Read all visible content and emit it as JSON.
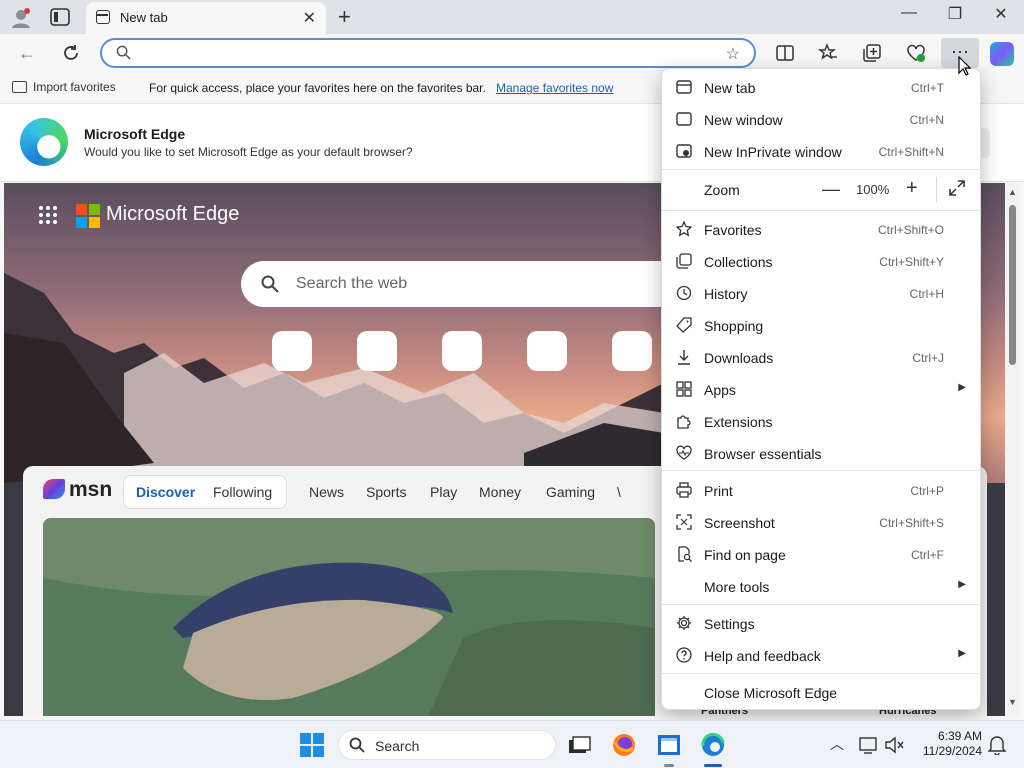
{
  "tab": {
    "title": "New tab"
  },
  "window": {
    "minimize": "—",
    "restore": "❐",
    "close": "✕"
  },
  "address": {
    "value": "",
    "placeholder": ""
  },
  "favorites_bar": {
    "import_label": "Import favorites",
    "message": "For quick access, place your favorites here on the favorites bar.",
    "manage_link": "Manage favorites now"
  },
  "banner": {
    "title": "Microsoft Edge",
    "subtitle": "Would you like to set Microsoft Edge as your default browser?"
  },
  "hero": {
    "brand": "Microsoft Edge",
    "search_placeholder": "Search the web"
  },
  "msn": {
    "logo": "msn",
    "nav": [
      "Discover",
      "Following",
      "News",
      "Sports",
      "Play",
      "Money",
      "Gaming",
      "\\"
    ],
    "bottom_labels": [
      "Panthers",
      "Hurricanes"
    ]
  },
  "menu": {
    "items": [
      {
        "label": "New tab",
        "shortcut": "Ctrl+T",
        "icon": "new-tab-icon"
      },
      {
        "label": "New window",
        "shortcut": "Ctrl+N",
        "icon": "window-icon"
      },
      {
        "label": "New InPrivate window",
        "shortcut": "Ctrl+Shift+N",
        "icon": "inprivate-icon"
      },
      {
        "label": "Favorites",
        "shortcut": "Ctrl+Shift+O",
        "icon": "star-icon"
      },
      {
        "label": "Collections",
        "shortcut": "Ctrl+Shift+Y",
        "icon": "collections-icon"
      },
      {
        "label": "History",
        "shortcut": "Ctrl+H",
        "icon": "history-icon"
      },
      {
        "label": "Shopping",
        "shortcut": "",
        "icon": "tag-icon"
      },
      {
        "label": "Downloads",
        "shortcut": "Ctrl+J",
        "icon": "download-icon"
      },
      {
        "label": "Apps",
        "shortcut": "",
        "icon": "apps-icon"
      },
      {
        "label": "Extensions",
        "shortcut": "",
        "icon": "puzzle-icon"
      },
      {
        "label": "Browser essentials",
        "shortcut": "",
        "icon": "heart-pulse-icon"
      },
      {
        "label": "Print",
        "shortcut": "Ctrl+P",
        "icon": "print-icon"
      },
      {
        "label": "Screenshot",
        "shortcut": "Ctrl+Shift+S",
        "icon": "screenshot-icon"
      },
      {
        "label": "Find on page",
        "shortcut": "Ctrl+F",
        "icon": "find-icon"
      },
      {
        "label": "More tools",
        "shortcut": "",
        "icon": ""
      },
      {
        "label": "Settings",
        "shortcut": "",
        "icon": "gear-icon"
      },
      {
        "label": "Help and feedback",
        "shortcut": "",
        "icon": "help-icon"
      },
      {
        "label": "Close Microsoft Edge",
        "shortcut": "",
        "icon": ""
      }
    ],
    "zoom": {
      "label": "Zoom",
      "value": "100%",
      "minus": "—",
      "plus": "+"
    }
  },
  "taskbar": {
    "search_label": "Search",
    "time": "6:39 AM",
    "date": "11/29/2024"
  },
  "colors": {
    "accent": "#1a5fb4",
    "address_border": "#5b8ed6",
    "menu_bg": "#ffffff"
  }
}
